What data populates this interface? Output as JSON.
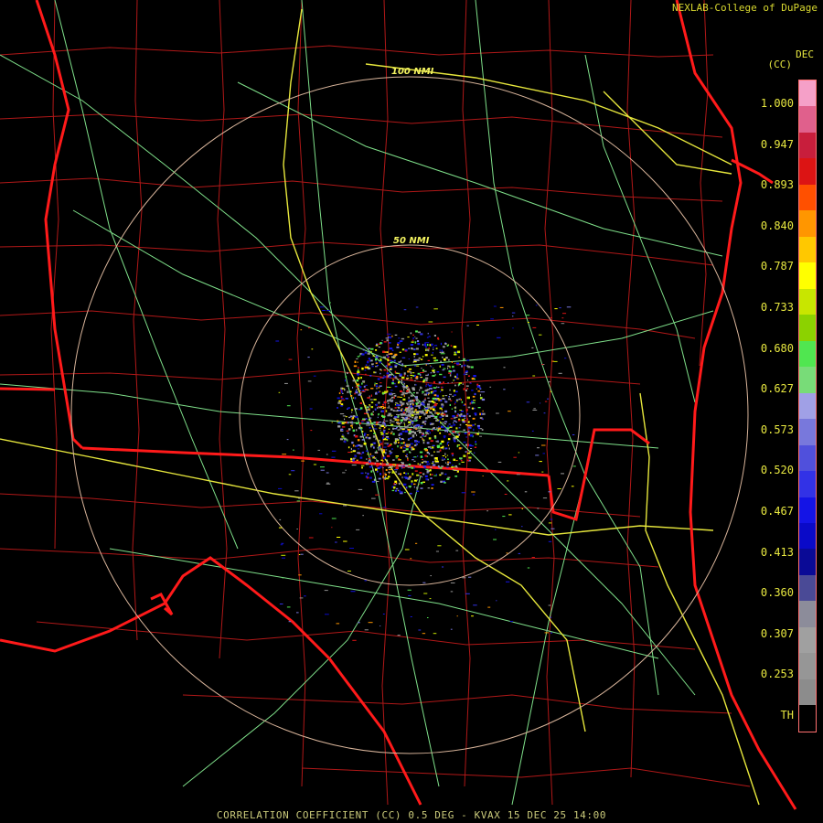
{
  "credit": "NEXLAB-College of DuPage",
  "colorbar": {
    "unit_abbr": "DEC",
    "unit_code": "(CC)",
    "tick_labels": [
      "1.000",
      "0.947",
      "0.893",
      "0.840",
      "0.787",
      "0.733",
      "0.680",
      "0.627",
      "0.573",
      "0.520",
      "0.467",
      "0.413",
      "0.360",
      "0.307",
      "0.253",
      "TH"
    ],
    "colors": [
      "#f5a0c8",
      "#e0608c",
      "#c81e3c",
      "#dc1414",
      "#ff5000",
      "#ff9600",
      "#ffc800",
      "#ffff00",
      "#c8e600",
      "#8cd200",
      "#50e650",
      "#78dc78",
      "#a0a0e6",
      "#7878dc",
      "#5050dc",
      "#3232e6",
      "#1414e6",
      "#0a0ac8",
      "#0a0a96",
      "#4a4a96",
      "#8c8c9a",
      "#a0a0a0",
      "#969696",
      "#8c8c8c",
      "#000000"
    ]
  },
  "range_rings": [
    "100 NMI",
    "50 NMI"
  ],
  "map_colors": {
    "state_border": "#ff1a1a",
    "county": "#b01818",
    "highway": "#e6e63c",
    "road": "#7fe08a",
    "ring": "#d8b49a"
  },
  "footer": "CORRELATION COEFFICIENT (CC) 0.5 DEG - KVAX 15 DEC 25 14:00"
}
